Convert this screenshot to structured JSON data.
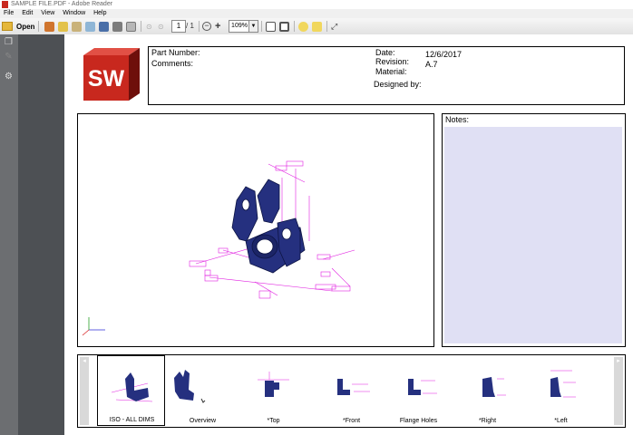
{
  "window": {
    "title": "SAMPLE FILE.PDF - Adobe Reader"
  },
  "menu": [
    "File",
    "Edit",
    "View",
    "Window",
    "Help"
  ],
  "toolbar": {
    "open_label": "Open",
    "page_current": "1",
    "page_total": "/ 1",
    "zoom": "109%"
  },
  "titleblock": {
    "part_number_label": "Part Number:",
    "comments_label": "Comments:",
    "date_label": "Date:",
    "date_value": "12/6/2017",
    "revision_label": "Revision:",
    "revision_value": "A.7",
    "material_label": "Material:",
    "designed_by_label": "Designed by:"
  },
  "logo": {
    "text": "SW",
    "color": "#c8281e"
  },
  "notes": {
    "label": "Notes:"
  },
  "views": [
    "ISO - ALL DIMS",
    "Overview",
    "*Top",
    "*Front",
    "Flange Holes",
    "*Right",
    "*Left"
  ],
  "colors": {
    "model": "#25307f",
    "dims": "#e01ee0",
    "notes_bg": "#e0e0f4",
    "gutter": "#4d5054"
  }
}
